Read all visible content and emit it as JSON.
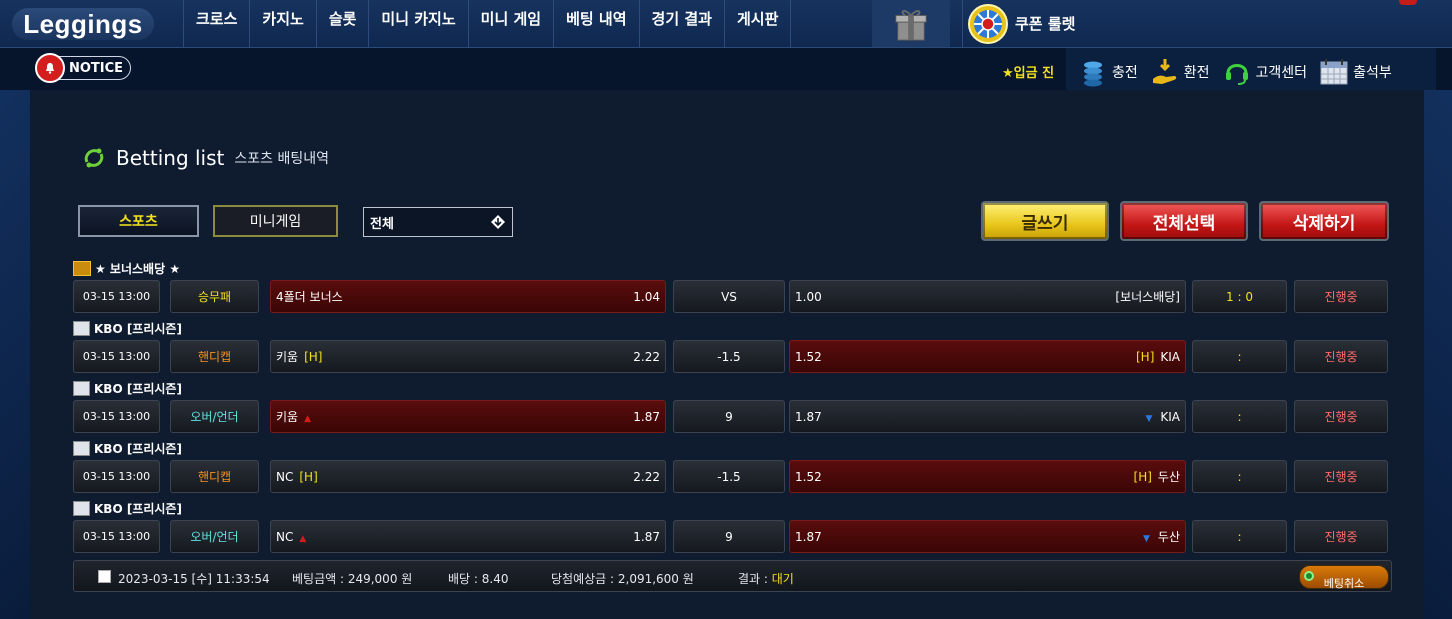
{
  "header": {
    "logo": "Leggings",
    "menu": [
      "크로스",
      "카지노",
      "슬롯",
      "미니 카지노",
      "미니 게임",
      "베팅 내역",
      "경기 결과",
      "게시판"
    ],
    "roulette_label": "쿠폰 룰렛",
    "notice_label": "NOTICE",
    "marquee": "★입금 진",
    "quick": [
      "충전",
      "환전",
      "고객센터",
      "출석부"
    ]
  },
  "page": {
    "title": "Betting list",
    "subtitle": "스포츠 배팅내역",
    "tabs": [
      "스포츠",
      "미니게임"
    ],
    "filter_value": "전체",
    "buttons": {
      "write": "글쓰기",
      "select_all": "전체선택",
      "delete": "삭제하기"
    }
  },
  "bets": [
    {
      "league": "★ 보너스배당 ★",
      "bonus": true,
      "date": "03-15 13:00",
      "type": "승무패",
      "type_color": "#f2e01e",
      "home": "4폴더 보너스",
      "home_tag": "",
      "home_odds": "1.04",
      "mid": "VS",
      "away_odds": "1.00",
      "away": "[보너스배당]",
      "away_tag": "",
      "score": "1 : 0",
      "status": "진행중",
      "selected": "home"
    },
    {
      "league": "KBO [프리시즌]",
      "bonus": false,
      "date": "03-15 13:00",
      "type": "핸디캡",
      "type_color": "#f7941d",
      "home": "키움",
      "home_tag": "[H]",
      "home_odds": "2.22",
      "mid": "-1.5",
      "away_odds": "1.52",
      "away": "KIA",
      "away_tag": "[H]",
      "score": ":",
      "status": "진행중",
      "selected": "away"
    },
    {
      "league": "KBO [프리시즌]",
      "bonus": false,
      "date": "03-15 13:00",
      "type": "오버/언더",
      "type_color": "#5fe0e0",
      "home": "키움",
      "home_tag": "▲",
      "home_odds": "1.87",
      "mid": "9",
      "away_odds": "1.87",
      "away": "KIA",
      "away_tag": "▼",
      "score": ":",
      "status": "진행중",
      "selected": "home"
    },
    {
      "league": "KBO [프리시즌]",
      "bonus": false,
      "date": "03-15 13:00",
      "type": "핸디캡",
      "type_color": "#f7941d",
      "home": "NC",
      "home_tag": "[H]",
      "home_odds": "2.22",
      "mid": "-1.5",
      "away_odds": "1.52",
      "away": "두산",
      "away_tag": "[H]",
      "score": ":",
      "status": "진행중",
      "selected": "away"
    },
    {
      "league": "KBO [프리시즌]",
      "bonus": false,
      "date": "03-15 13:00",
      "type": "오버/언더",
      "type_color": "#5fe0e0",
      "home": "NC",
      "home_tag": "▲",
      "home_odds": "1.87",
      "mid": "9",
      "away_odds": "1.87",
      "away": "두산",
      "away_tag": "▼",
      "score": ":",
      "status": "진행중",
      "selected": "away"
    }
  ],
  "summary": {
    "datetime": "2023-03-15 [수] 11:33:54",
    "amount": "베팅금액 : 249,000 원",
    "odds": "배당 : 8.40",
    "expected": "당첨예상금 : 2,091,600 원",
    "result_label": "결과 : ",
    "result_value": "대기",
    "cancel": "베팅취소"
  },
  "colors": {
    "accent_yellow": "#f2e01e",
    "status_red": "#ff6a6a",
    "selected_bg": "#5a0c0c"
  }
}
